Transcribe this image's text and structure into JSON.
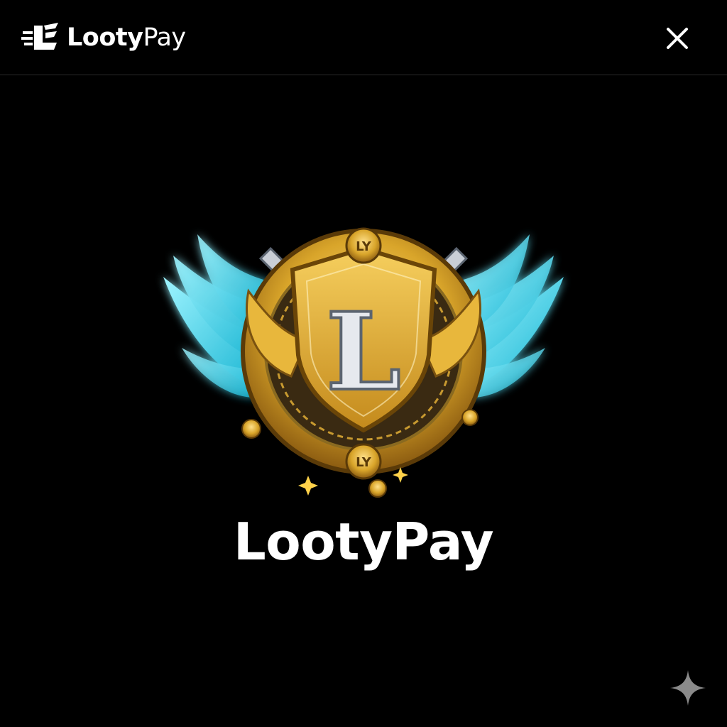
{
  "header": {
    "brand_bold": "Looty",
    "brand_regular": "Pay",
    "close_icon": "close-icon"
  },
  "emblem": {
    "shield_letter": "L",
    "coin_text": "LY",
    "colors": {
      "gold": "#d9a52a",
      "wing": "#35d8ef",
      "steel": "#c9ced6"
    }
  },
  "main": {
    "app_name": "LootyPay"
  },
  "corner": {
    "icon": "sparkle-icon"
  }
}
